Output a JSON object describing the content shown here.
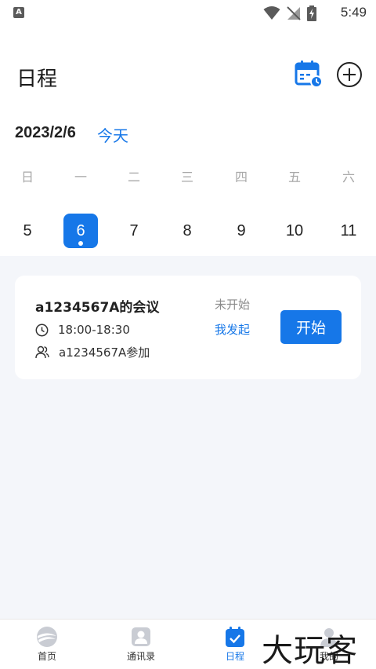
{
  "status_bar": {
    "time": "5:49",
    "left_icon_letter": "A"
  },
  "header": {
    "title": "日程"
  },
  "date_bar": {
    "current_date": "2023/2/6",
    "today_label": "今天"
  },
  "week": {
    "weekdays": [
      "日",
      "一",
      "二",
      "三",
      "四",
      "五",
      "六"
    ],
    "days": [
      "5",
      "6",
      "7",
      "8",
      "9",
      "10",
      "11"
    ],
    "selected_index": 1
  },
  "meeting": {
    "title": "a1234567A的会议",
    "time": "18:00-18:30",
    "attendees": "a1234567A参加",
    "status": "未开始",
    "initiator": "我发起",
    "start_label": "开始"
  },
  "nav": {
    "items": [
      {
        "label": "首页",
        "icon": "home-icon"
      },
      {
        "label": "通讯录",
        "icon": "contacts-icon"
      },
      {
        "label": "日程",
        "icon": "schedule-icon"
      },
      {
        "label": "我的",
        "icon": "profile-icon"
      }
    ],
    "active_index": 2
  },
  "watermark": "大玩客",
  "colors": {
    "accent": "#1677e8",
    "background": "#f4f6fa",
    "muted": "#a8a8a8"
  }
}
